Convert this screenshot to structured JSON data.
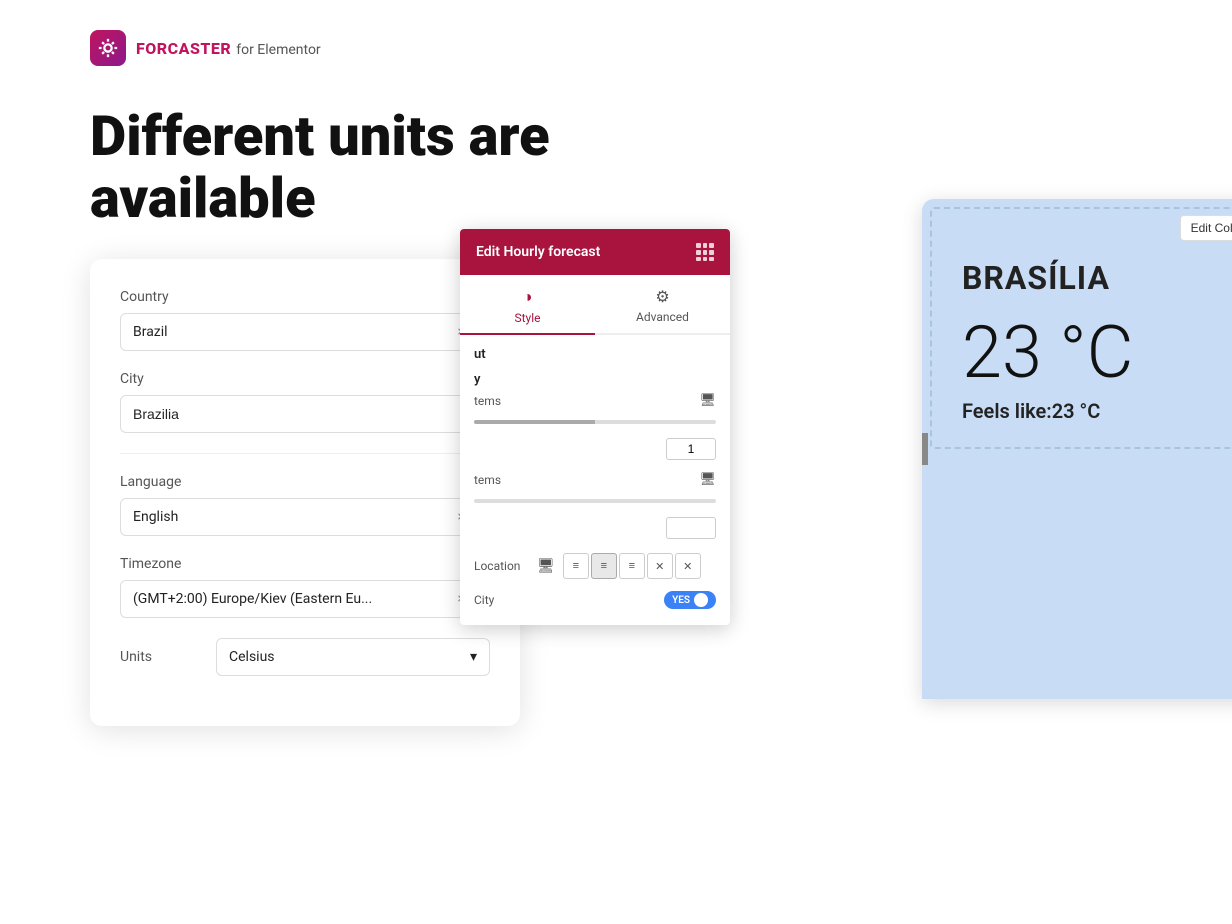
{
  "header": {
    "logo_brand": "FORCASTER",
    "logo_sub": "for Elementor"
  },
  "hero": {
    "title_line1": "Different units are",
    "title_line2": "available"
  },
  "form": {
    "country_label": "Country",
    "country_value": "Brazil",
    "city_label": "City",
    "city_value": "Brazilia",
    "language_label": "Language",
    "language_value": "English",
    "timezone_label": "Timezone",
    "timezone_value": "(GMT+2:00) Europe/Kiev (Eastern Eu...",
    "units_label": "Units",
    "units_value": "Celsius"
  },
  "edit_panel": {
    "title": "Edit Hourly forecast",
    "tabs": [
      {
        "label": "Style",
        "icon": "◑"
      },
      {
        "label": "Advanced",
        "icon": "⚙"
      }
    ],
    "section_label_1": "ut",
    "items_label_1": "y",
    "items_label_2": "tems",
    "number_value_1": "1",
    "number_value_2": "",
    "location_label": "Location",
    "city_label": "City",
    "toggle_yes": "YES",
    "align_buttons": [
      "≡",
      "≡",
      "≡",
      "✕",
      "✕"
    ]
  },
  "weather": {
    "city_name": "BRASÍLIA",
    "temperature": "23 °C",
    "feels_like": "Feels like:23 °C"
  },
  "buttons": {
    "edit_column": "Edit Column"
  }
}
